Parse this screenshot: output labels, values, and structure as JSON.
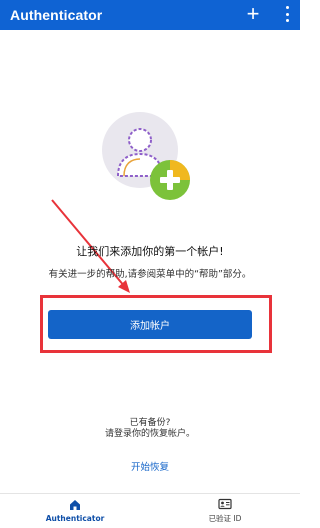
{
  "appbar": {
    "title": "Authenticator",
    "add_icon": "plus-icon",
    "more_icon": "more-vertical-icon"
  },
  "illustration": {
    "icon": "add-account-person-plus-icon"
  },
  "main": {
    "headline": "让我们来添加你的第一个帐户!",
    "help_text": "有关进一步的帮助,请参阅菜单中的“帮助”部分。",
    "add_account_button": "添加帐户"
  },
  "backup": {
    "line1": "已有备份?",
    "line2": "请登录你的恢复帐户。",
    "restore_link": "开始恢复"
  },
  "bottom_nav": {
    "items": [
      {
        "label": "Authenticator",
        "icon": "home-icon",
        "active": true
      },
      {
        "label": "已验证 ID",
        "icon": "id-card-icon",
        "active": false
      }
    ]
  },
  "colors": {
    "primary": "#0f63d3",
    "button": "#1464c8",
    "highlight_annotation": "#e8333a",
    "arrow_annotation": "#e8333a"
  }
}
